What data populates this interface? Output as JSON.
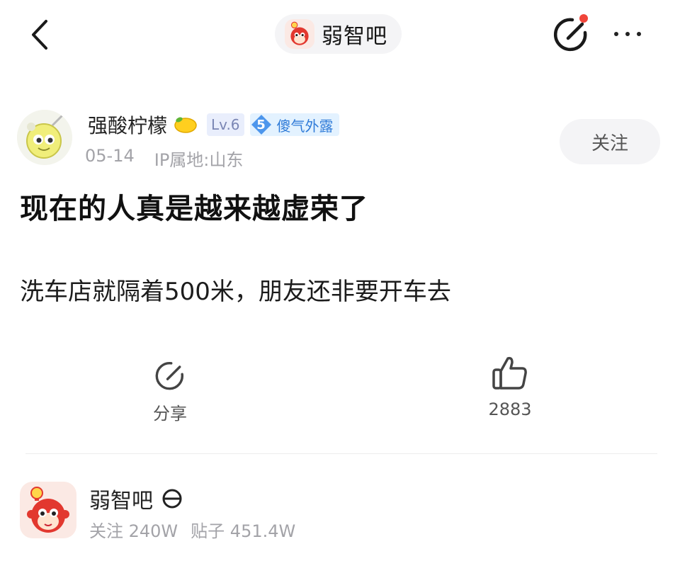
{
  "header": {
    "back_icon": "chevron-left-icon",
    "forum_name": "弱智吧",
    "edit_icon": "edit-share-icon",
    "more_icon": "more-dots-icon",
    "notification_dot_color": "#f0453a"
  },
  "author": {
    "name": "强酸柠檬",
    "emoji_icon": "lemon-icon",
    "level": "Lv.6",
    "title_level": "5",
    "title_name": "傻气外露",
    "date": "05-14",
    "ip_location": "IP属地:山东",
    "follow_label": "关注"
  },
  "post": {
    "title": "现在的人真是越来越虚荣了",
    "body": "洗车店就隔着500米，朋友还非要开车去"
  },
  "actions": {
    "share_label": "分享",
    "like_count": "2883"
  },
  "forum_card": {
    "name": "弱智吧",
    "badge_icon": "no-entry-circle-icon",
    "followers": "关注 240W",
    "posts": "贴子 451.4W"
  },
  "colors": {
    "accent_blue": "#2f7bd8",
    "muted_text": "#a3a3a8",
    "mascot_red": "#e2382f"
  }
}
